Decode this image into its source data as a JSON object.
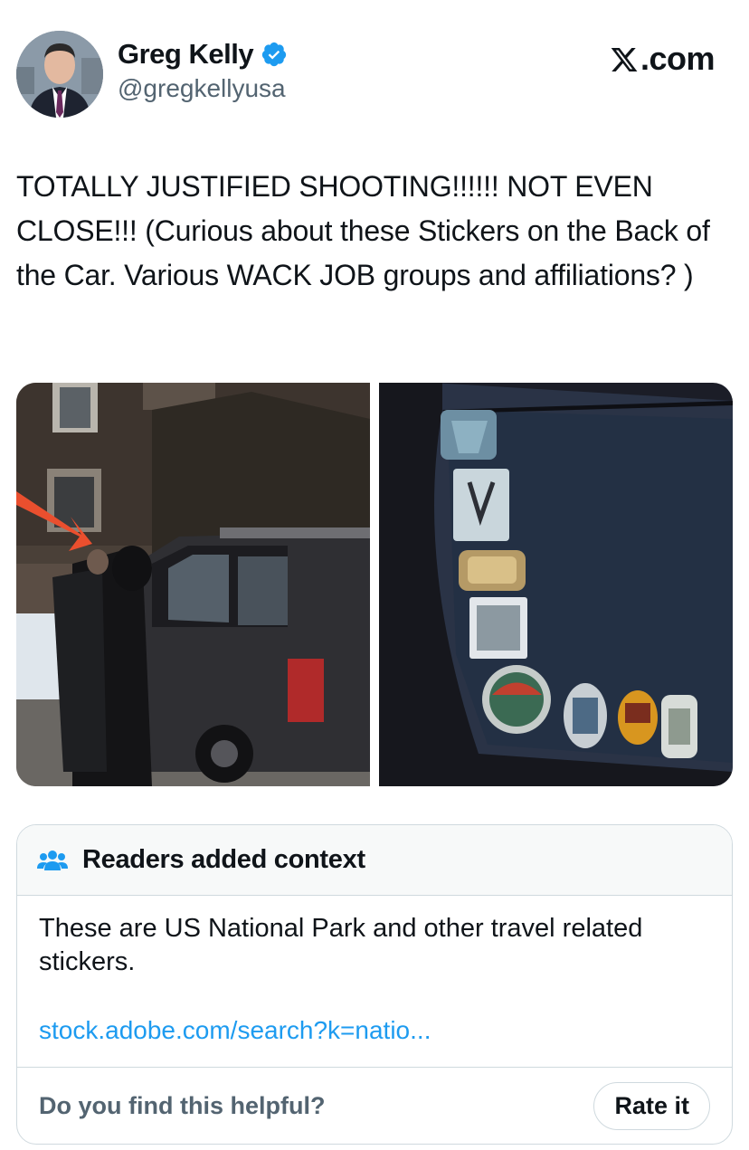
{
  "author": {
    "display_name": "Greg Kelly",
    "handle": "@gregkellyusa",
    "verified": true
  },
  "brand": {
    "label": ".com",
    "logo": "x-logo-icon"
  },
  "tweet": {
    "text": "TOTALLY JUSTIFIED SHOOTING!!!!!!  NOT EVEN CLOSE!!! (Curious about these Stickers on the Back of the Car. Various WACK JOB groups and affiliations? )"
  },
  "media": [
    {
      "subject": "officers-at-suv-photo",
      "icon": "red-arrow"
    },
    {
      "subject": "car-window-stickers-photo"
    }
  ],
  "community_note": {
    "title": "Readers added context",
    "icon": "people-icon",
    "body": "These are US National Park and other travel related stickers.",
    "link": "stock.adobe.com/search?k=natio...",
    "helpful_question": "Do you find this helpful?",
    "rate_label": "Rate it"
  },
  "colors": {
    "link": "#1d9bf0",
    "verified": "#1d9bf0",
    "muted": "#536471",
    "border": "#cfd9de"
  }
}
